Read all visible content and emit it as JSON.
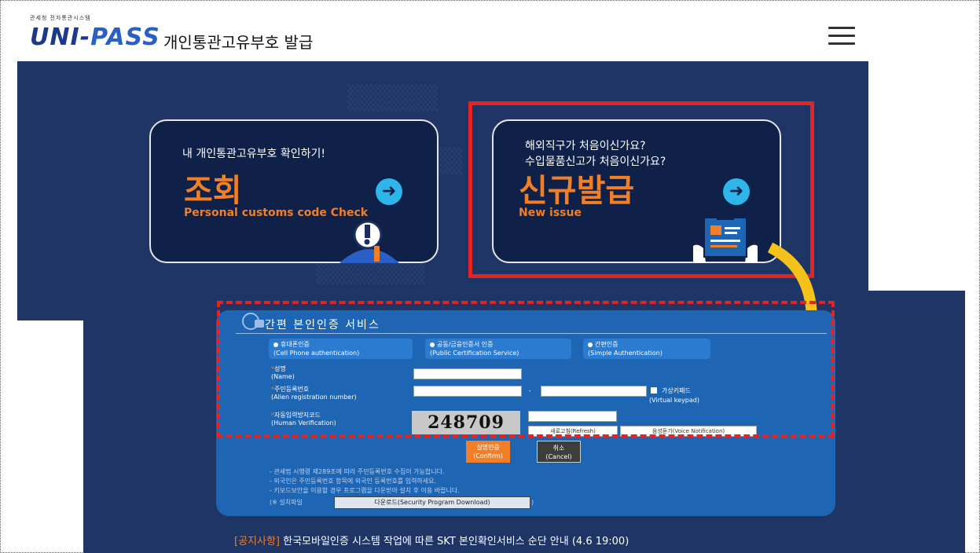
{
  "header": {
    "logo_small": "관세청 전자통관시스템",
    "logo_main": "UNI-",
    "logo_main2": "PASS",
    "title": "개인통관고유부호 발급",
    "menu_icon": "hamburger-menu-icon"
  },
  "cards": {
    "check": {
      "subtitle": "내 개인통관고유부호 확인하기!",
      "title": "조회",
      "english": "Personal customs code Check"
    },
    "new": {
      "subtitle1": "해외직구가 처음이신가요?",
      "subtitle2": "수입물품신고가 처음이신가요?",
      "title": "신규발급",
      "english": "New issue"
    }
  },
  "auth": {
    "title": "간편 본인인증 서비스",
    "options": [
      {
        "ko": "휴대폰인증",
        "en": "(Cell Phone authentication)"
      },
      {
        "ko": "공동/금융인증서 인증",
        "en": "(Public Certification Service)"
      },
      {
        "ko": "간편인증",
        "en": "(Simple Authentication)"
      }
    ],
    "name_label": "성명",
    "name_label_en": "(Name)",
    "reg_label": "주민등록번호",
    "reg_label_en": "(Alien registration number)",
    "reg_separator": "-",
    "virtual_keypad": "가상키패드",
    "virtual_keypad_en": "(Virtual keypad)",
    "captcha_label": "자동입력방지코드",
    "captcha_label_en": "(Human Verification)",
    "captcha_code": "248709",
    "refresh": "새로고침(Refresh)",
    "voice": "음성듣기(Voice Notification)",
    "confirm": "실명인증",
    "confirm_en": "(Confirm)",
    "cancel": "취소",
    "cancel_en": "(Cancel)",
    "notes": [
      "- 관세법 시행령 제289조에 따라 주민등록번호 수집이 가능합니다.",
      "- 외국인은 주민등록번호 항목에 외국인 등록번호를 입력하세요.",
      "- 키보드보안을 이용할 경우 프로그램을 다운받아 설치 후 이용 바랍니다."
    ],
    "install_label": "(※ 설치파일",
    "download": "다운로드(Security Program Download)",
    "install_close": ")"
  },
  "notice": {
    "tag": "[공지사항]",
    "text": "한국모바일인증 시스템 작업에 따른 SKT 본인확인서비스 순단 안내 (4.6 19:00)"
  },
  "colors": {
    "panel": "#1f3566",
    "accent": "#f07f28",
    "highlight": "#e32424",
    "auth_box": "#1e66b3"
  }
}
